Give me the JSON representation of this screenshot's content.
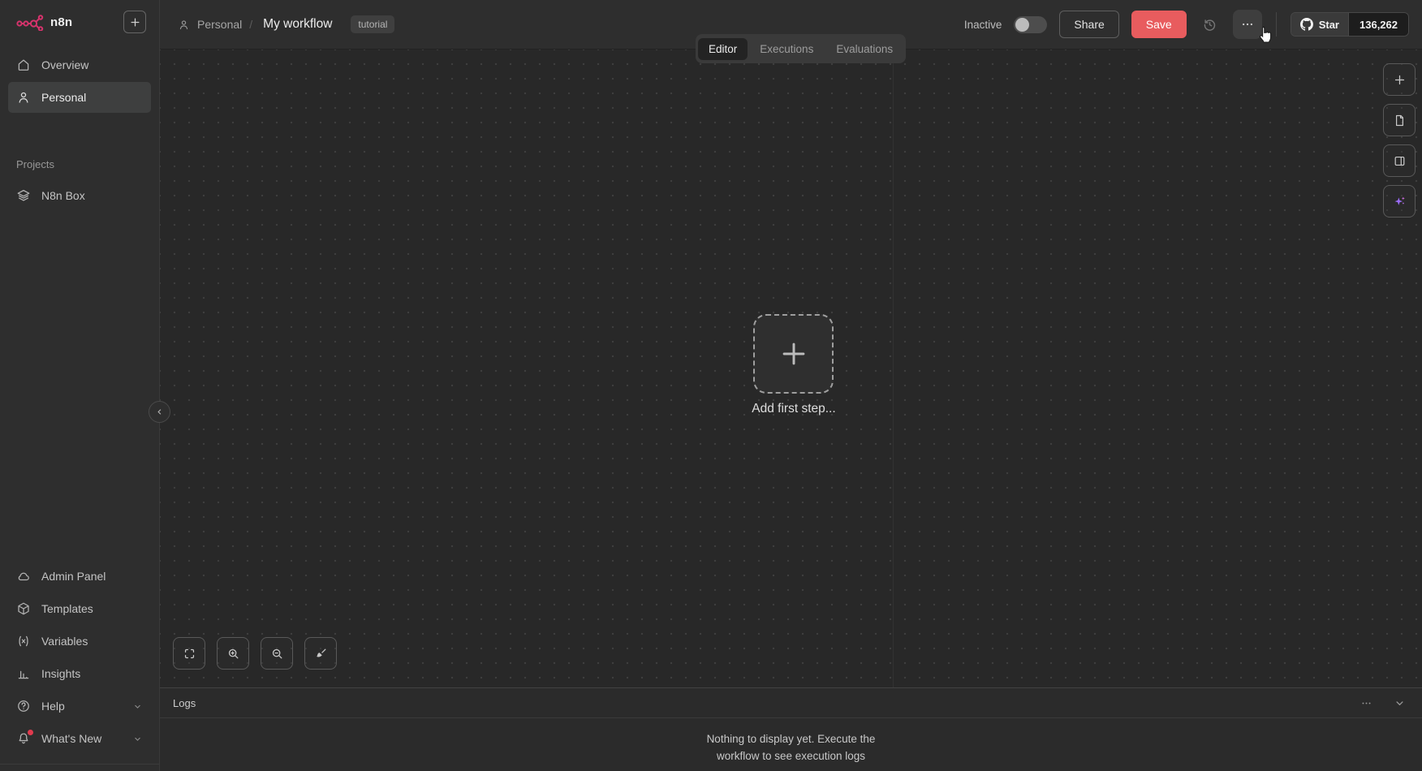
{
  "brand": {
    "name": "n8n",
    "color": "#d6336c"
  },
  "colors": {
    "save_button": "#e85c5e",
    "ai_accent": "#9b6cf7",
    "notification_dot": "#e23a4e",
    "sidebar_bg": "#2e2e2e",
    "canvas_bg": "#282828"
  },
  "sidebar": {
    "nav_top": [
      {
        "icon": "home-icon",
        "label": "Overview",
        "active": false
      },
      {
        "icon": "user-icon",
        "label": "Personal",
        "active": true
      }
    ],
    "projects_heading": "Projects",
    "projects": [
      {
        "icon": "layers-icon",
        "label": "N8n Box"
      }
    ],
    "nav_bottom": [
      {
        "icon": "cloud-icon",
        "label": "Admin Panel"
      },
      {
        "icon": "package-icon",
        "label": "Templates"
      },
      {
        "icon": "variable-icon",
        "label": "Variables"
      },
      {
        "icon": "bar-chart-icon",
        "label": "Insights"
      },
      {
        "icon": "help-icon",
        "label": "Help",
        "expandable": true
      },
      {
        "icon": "bell-icon",
        "label": "What's New",
        "expandable": true,
        "has_notification": true
      }
    ]
  },
  "header": {
    "breadcrumb": {
      "project": "Personal",
      "separator": "/",
      "workflow_title": "My workflow",
      "tag": "tutorial"
    },
    "activation": {
      "label": "Inactive",
      "enabled": false
    },
    "share_label": "Share",
    "save_label": "Save",
    "github": {
      "star_label": "Star",
      "star_count": "136,262"
    }
  },
  "tabs": [
    {
      "label": "Editor",
      "active": true
    },
    {
      "label": "Executions",
      "active": false
    },
    {
      "label": "Evaluations",
      "active": false
    }
  ],
  "canvas": {
    "add_first_step_label": "Add first step..."
  },
  "logs": {
    "title": "Logs",
    "empty_message": "Nothing to display yet. Execute the workflow to see execution logs"
  }
}
